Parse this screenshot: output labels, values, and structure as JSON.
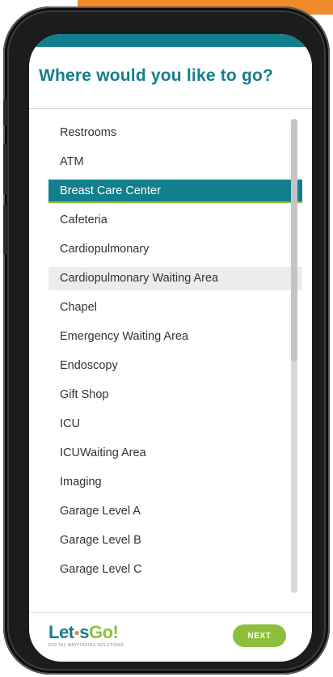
{
  "header": {
    "title": "Where would you like to go?"
  },
  "destinations": [
    {
      "label": "Restrooms",
      "state": "normal"
    },
    {
      "label": "ATM",
      "state": "normal"
    },
    {
      "label": "Breast Care Center",
      "state": "selected"
    },
    {
      "label": "Cafeteria",
      "state": "normal"
    },
    {
      "label": "Cardiopulmonary",
      "state": "normal"
    },
    {
      "label": "Cardiopulmonary Waiting Area",
      "state": "hover"
    },
    {
      "label": "Chapel",
      "state": "normal"
    },
    {
      "label": "Emergency Waiting Area",
      "state": "normal"
    },
    {
      "label": "Endoscopy",
      "state": "normal"
    },
    {
      "label": "Gift Shop",
      "state": "normal"
    },
    {
      "label": "ICU",
      "state": "normal"
    },
    {
      "label": "ICUWaiting Area",
      "state": "normal"
    },
    {
      "label": "Imaging",
      "state": "normal"
    },
    {
      "label": "Garage Level A",
      "state": "normal"
    },
    {
      "label": "Garage Level B",
      "state": "normal"
    },
    {
      "label": "Garage Level C",
      "state": "normal"
    }
  ],
  "footer": {
    "logo_lets": "Let",
    "logo_s": "s",
    "logo_go": "Go!",
    "logo_tagline": "DIGITAL WAYFINDING SOLUTIONS",
    "next_label": "NEXT"
  },
  "colors": {
    "brand_teal": "#127f8e",
    "accent_green": "#8dbf3a",
    "accent_orange": "#f08a2b"
  }
}
